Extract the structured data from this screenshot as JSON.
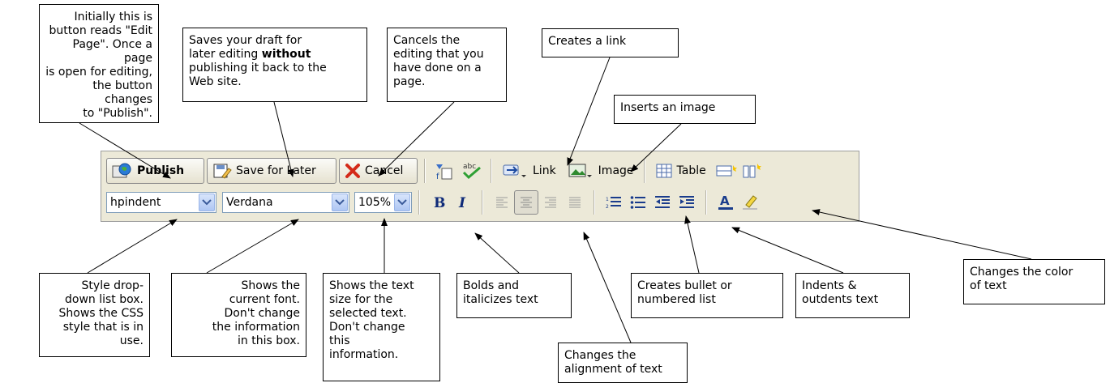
{
  "toolbar": {
    "publish_label": "Publish",
    "save_later_label": "Save for Later",
    "cancel_label": "Cancel",
    "link_label": "Link",
    "image_label": "Image",
    "table_label": "Table",
    "style_value": "hpindent",
    "font_value": "Verdana",
    "size_value": "105%"
  },
  "callouts": {
    "publish": [
      "Initially this is",
      "button reads \"Edit",
      "Page\". Once a page",
      "is open for editing,",
      "the button changes",
      "to \"Publish\"."
    ],
    "save": {
      "line1": "Saves your draft for",
      "line2": "later editing",
      "line2_bold": "without",
      "line3": "publishing it back to the",
      "line4": "Web site."
    },
    "cancel": [
      "Cancels the",
      "editing that you",
      "have done on a",
      "page."
    ],
    "link": "Creates a link",
    "image": "Inserts an image",
    "style": [
      "Style drop-",
      "down list box.",
      "Shows the CSS",
      "style that is in",
      "use."
    ],
    "font": [
      "Shows the",
      "current font.",
      "Don't change",
      "the information",
      "in this box."
    ],
    "size": [
      "Shows the text",
      "size for the",
      "selected text.",
      "Don't change",
      "this",
      "information."
    ],
    "bold": [
      "Bolds and",
      "italicizes text"
    ],
    "align": [
      "Changes the",
      "alignment of text"
    ],
    "list": [
      "Creates bullet or",
      "numbered list"
    ],
    "indent": [
      "Indents &",
      "outdents text"
    ],
    "color": [
      "Changes the color",
      "of text"
    ]
  },
  "colors": {
    "toolbar_bg": "#ece9d8",
    "combo_border": "#7f9db9",
    "cancel_red": "#d42a1a"
  }
}
